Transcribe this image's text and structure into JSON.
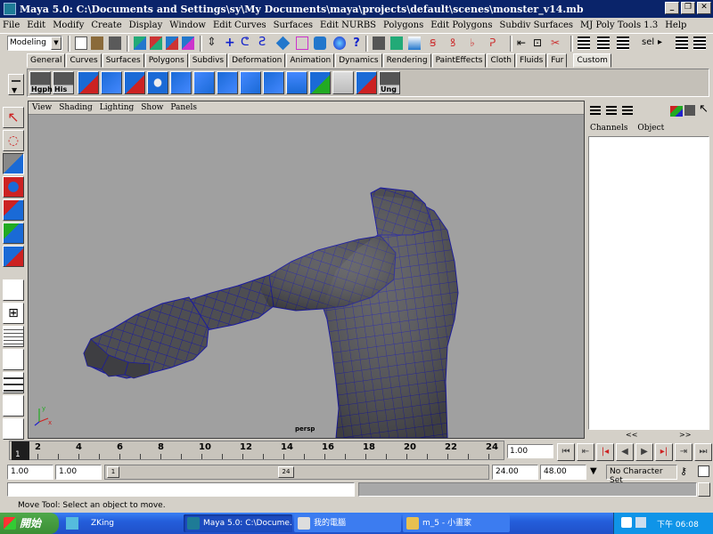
{
  "window": {
    "title": "Maya 5.0: C:\\Documents and Settings\\sy\\My Documents\\maya\\projects\\default\\scenes\\monster_v14.mb"
  },
  "menus": [
    "File",
    "Edit",
    "Modify",
    "Create",
    "Display",
    "Window",
    "Edit Curves",
    "Surfaces",
    "Edit NURBS",
    "Polygons",
    "Edit Polygons",
    "Subdiv Surfaces",
    "MJ Poly Tools 1.3",
    "Help"
  ],
  "status_line": {
    "mode": "Modeling",
    "sel_label": "sel"
  },
  "shelf_tabs": [
    "General",
    "Curves",
    "Surfaces",
    "Polygons",
    "Subdivs",
    "Deformation",
    "Animation",
    "Dynamics",
    "Rendering",
    "PaintEffects",
    "Cloth",
    "Fluids",
    "Fur",
    "Custom"
  ],
  "shelf_labels": {
    "hyper": "Hgph",
    "hist": "His",
    "ung": "Ung"
  },
  "viewport": {
    "menus": [
      "View",
      "Shading",
      "Lighting",
      "Show",
      "Panels"
    ],
    "camera": "persp",
    "axis_y": "y",
    "axis_x": "x"
  },
  "channel_box": {
    "headers": [
      "Channels",
      "Object"
    ],
    "scroll_left": "<<",
    "scroll_right": ">>"
  },
  "timeline": {
    "ticks": [
      "2",
      "4",
      "6",
      "8",
      "10",
      "12",
      "14",
      "16",
      "18",
      "20",
      "22",
      "24"
    ],
    "current_frame_marker": "1",
    "current_frame": "1.00"
  },
  "range": {
    "start": "1.00",
    "inner_start": "1.00",
    "inner_end": "24.00",
    "end": "48.00",
    "handle_left": "1",
    "handle_right": "24",
    "character_set": "No Character Set"
  },
  "help_line": "Move Tool: Select an object to move.",
  "taskbar": {
    "start": "開始",
    "tasks": [
      "ZKing",
      "Maya 5.0: C:\\Docume...",
      "我的電腦",
      "m_5 - 小畫家"
    ],
    "lang": "EN",
    "clock": "下午 06:08"
  },
  "colors": {
    "title_bar": "#0a246a",
    "viewport_bg": "#a0a0a0",
    "mesh": "#4e4e52",
    "wire": "#1a1aa0",
    "taskbar": "#245edb"
  }
}
